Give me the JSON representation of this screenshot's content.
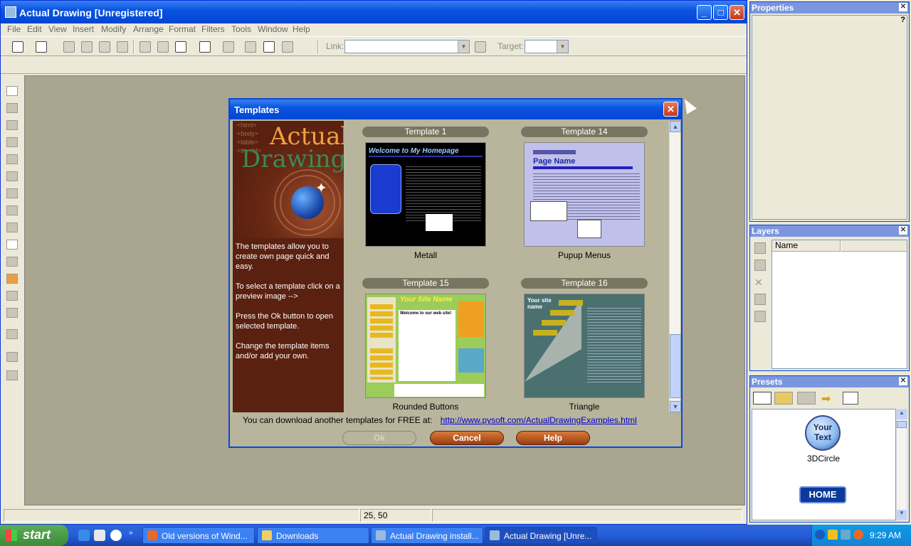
{
  "window": {
    "title": "Actual Drawing [Unregistered]",
    "minimize": "_",
    "maximize": "□",
    "close": "✕"
  },
  "menu": [
    "File",
    "Edit",
    "View",
    "Insert",
    "Modify",
    "Arrange",
    "Format",
    "Filters",
    "Tools",
    "Window",
    "Help"
  ],
  "toolbar": {
    "link_label": "Link:",
    "link_value": "",
    "target_label": "Target:",
    "target_value": ""
  },
  "status": {
    "coords": "25, 50"
  },
  "dialog": {
    "title": "Templates",
    "close": "✕",
    "logo_word1": "Actual",
    "logo_word2": "Drawing",
    "code_snippet": "<html>\n<body>\n<table>\n<tr><td>",
    "intro": "The templates allow you to create own page quick and easy.",
    "instr1": "To select a template click on a preview image -->",
    "instr2": "Press the Ok button to open selected template.",
    "instr3": "Change the template items and/or add your own.",
    "templates": [
      {
        "label": "Template 1",
        "name": "Metall",
        "preview_heading": "Welcome to My Homepage"
      },
      {
        "label": "Template 14",
        "name": "Pupup Menus",
        "preview_heading": "Page Name"
      },
      {
        "label": "Template 15",
        "name": "Rounded Buttons",
        "preview_heading": "Your Site Name",
        "preview_sub": "Welcome to our web site!"
      },
      {
        "label": "Template 16",
        "name": "Triangle",
        "preview_heading": "Your site name"
      }
    ],
    "footer_text": "You can download another templates for FREE at:",
    "footer_link": "http://www.pysoft.com/ActualDrawingExamples.html",
    "btn_ok": "Ok",
    "btn_cancel": "Cancel",
    "btn_help": "Help"
  },
  "panels": {
    "properties": {
      "title": "Properties",
      "help": "?"
    },
    "layers": {
      "title": "Layers",
      "col_name": "Name"
    },
    "presets": {
      "title": "Presets",
      "preset1_text": "Your Text",
      "preset1_name": "3DCircle",
      "preset2_text": "HOME"
    }
  },
  "taskbar": {
    "start": "start",
    "tasks": [
      {
        "label": "Old versions of Wind..."
      },
      {
        "label": "Downloads"
      },
      {
        "label": "Actual Drawing install..."
      },
      {
        "label": "Actual Drawing [Unre..."
      }
    ],
    "clock": "9:29 AM"
  }
}
